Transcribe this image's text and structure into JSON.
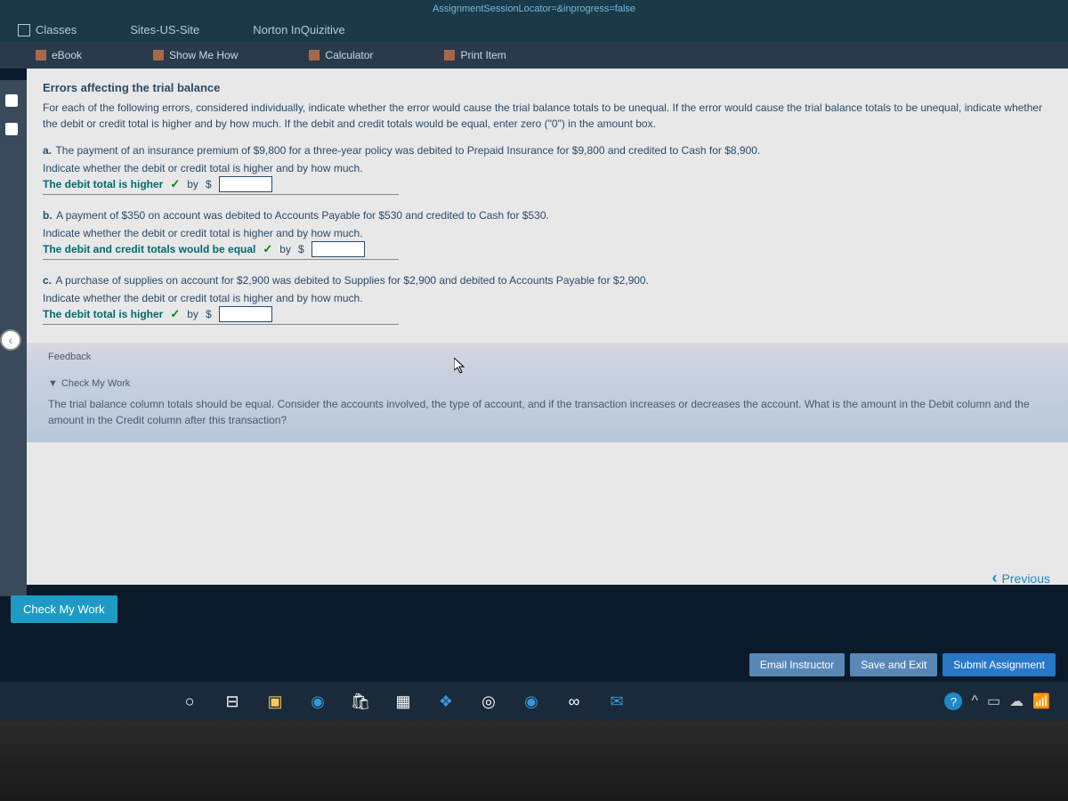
{
  "url_fragment": "AssignmentSessionLocator=&inprogress=false",
  "nav": {
    "classes": "Classes",
    "sites": "Sites-US-Site",
    "norton": "Norton InQuizitive"
  },
  "tools": {
    "ebook": "eBook",
    "show_me": "Show Me How",
    "calculator": "Calculator",
    "print": "Print Item"
  },
  "section_title": "Errors affecting the trial balance",
  "instructions": "For each of the following errors, considered individually, indicate whether the error would cause the trial balance totals to be unequal. If the error would cause the trial balance totals to be unequal, indicate whether the debit or credit total is higher and by how much. If the debit and credit totals would be equal, enter zero (\"0\") in the amount box.",
  "questions": {
    "a": {
      "letter": "a.",
      "text": "The payment of an insurance premium of $9,800 for a three-year policy was debited to Prepaid Insurance for $9,800 and credited to Cash for $8,900.",
      "prompt": "Indicate whether the debit or credit total is higher and by how much.",
      "answer": "The debit total is higher",
      "by": "by",
      "dollar": "$"
    },
    "b": {
      "letter": "b.",
      "text": "A payment of $350 on account was debited to Accounts Payable for $530 and credited to Cash for $530.",
      "prompt": "Indicate whether the debit or credit total is higher and by how much.",
      "answer": "The debit and credit totals would be equal",
      "by": "by",
      "dollar": "$"
    },
    "c": {
      "letter": "c.",
      "text": "A purchase of supplies on account for $2,900 was debited to Supplies for $2,900 and debited to Accounts Payable for $2,900.",
      "prompt": "Indicate whether the debit or credit total is higher and by how much.",
      "answer": "The debit total is higher",
      "by": "by",
      "dollar": "$"
    }
  },
  "feedback_label": "Feedback",
  "cmw_label": "Check My Work",
  "hint_text": "The trial balance column totals should be equal. Consider the accounts involved, the type of account, and if the transaction increases or decreases the account. What is the amount in the Debit column and the amount in the Credit column after this transaction?",
  "previous": "Previous",
  "check_my_work": "Check My Work",
  "footer": {
    "email": "Email Instructor",
    "save": "Save and Exit",
    "submit": "Submit Assignment"
  },
  "check_mark": "✓",
  "dropdown_arrow": "▼"
}
